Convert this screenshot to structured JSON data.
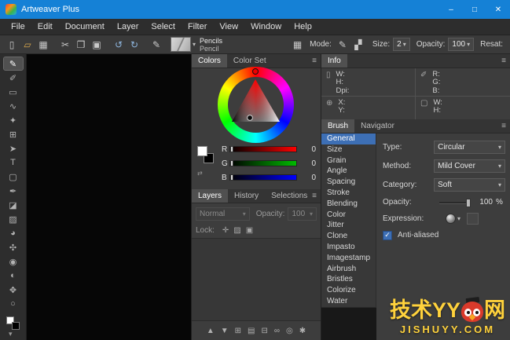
{
  "window": {
    "title": "Artweaver Plus",
    "minimize": "–",
    "maximize": "□",
    "close": "✕"
  },
  "menubar": {
    "items": [
      {
        "label": "File"
      },
      {
        "label": "Edit"
      },
      {
        "label": "Document"
      },
      {
        "label": "Layer"
      },
      {
        "label": "Select"
      },
      {
        "label": "Filter"
      },
      {
        "label": "View"
      },
      {
        "label": "Window"
      },
      {
        "label": "Help"
      }
    ]
  },
  "toolbar": {
    "icons": [
      {
        "name": "new-document-icon",
        "glyph": "▯"
      },
      {
        "name": "open-icon",
        "glyph": "▱",
        "color": "#d9a94e"
      },
      {
        "name": "save-icon",
        "glyph": "▦"
      },
      {
        "name": "cut-icon",
        "glyph": "✂"
      },
      {
        "name": "copy-icon",
        "glyph": "❐"
      },
      {
        "name": "paste-icon",
        "glyph": "▣"
      },
      {
        "name": "undo-icon",
        "glyph": "↺",
        "color": "#8fb7e0"
      },
      {
        "name": "redo-icon",
        "glyph": "↻",
        "color": "#8fb7e0"
      },
      {
        "name": "brush-icon",
        "glyph": "✎"
      }
    ],
    "brush_preset": {
      "line1": "Pencils",
      "line2": "Pencil"
    },
    "palette_icon": "▦",
    "mode_label": "Mode:",
    "mode_icons": [
      {
        "name": "paint-mode-icon",
        "glyph": "✎"
      },
      {
        "name": "erase-mode-icon",
        "glyph": "▞"
      }
    ],
    "size_label": "Size:",
    "size_value": "2",
    "opacity_label": "Opacity:",
    "opacity_value": "100",
    "resat_label": "Resat:"
  },
  "tools": [
    {
      "name": "brush-tool",
      "glyph": "✎",
      "selected": true
    },
    {
      "name": "pencil-tool",
      "glyph": "✐"
    },
    {
      "name": "rect-select-tool",
      "glyph": "▭"
    },
    {
      "name": "lasso-tool",
      "glyph": "∿"
    },
    {
      "name": "magic-wand-tool",
      "glyph": "✦"
    },
    {
      "name": "crop-tool",
      "glyph": "⊞"
    },
    {
      "name": "move-tool",
      "glyph": "➤"
    },
    {
      "name": "text-tool",
      "glyph": "T"
    },
    {
      "name": "shape-tool",
      "glyph": "▢"
    },
    {
      "name": "eyedropper-tool",
      "glyph": "✒"
    },
    {
      "name": "eraser-tool",
      "glyph": "◪"
    },
    {
      "name": "gradient-tool",
      "glyph": "▨"
    },
    {
      "name": "fill-tool",
      "glyph": "◕"
    },
    {
      "name": "smudge-tool",
      "glyph": "✣"
    },
    {
      "name": "clone-tool",
      "glyph": "◉"
    },
    {
      "name": "dodge-tool",
      "glyph": "◐"
    },
    {
      "name": "hand-tool",
      "glyph": "✥"
    },
    {
      "name": "zoom-tool",
      "glyph": "○"
    }
  ],
  "colors_panel": {
    "tabs": [
      {
        "label": "Colors",
        "selected": true
      },
      {
        "label": "Color Set"
      }
    ],
    "sliders": [
      {
        "label": "R",
        "value": "0",
        "color": "#ff0000"
      },
      {
        "label": "G",
        "value": "0",
        "color": "#00bb00"
      },
      {
        "label": "B",
        "value": "0",
        "color": "#0000ff"
      }
    ]
  },
  "layers_panel": {
    "tabs": [
      {
        "label": "Layers",
        "selected": true
      },
      {
        "label": "History"
      },
      {
        "label": "Selections"
      }
    ],
    "blend_mode": "Normal",
    "opacity_label": "Opacity:",
    "opacity_value": "100",
    "lock_label": "Lock:",
    "lock_icons": [
      {
        "name": "lock-position-icon",
        "glyph": "✛"
      },
      {
        "name": "lock-pixels-icon",
        "glyph": "▨"
      },
      {
        "name": "lock-all-icon",
        "glyph": "▣"
      }
    ],
    "bottom_icons": [
      {
        "name": "move-up-icon",
        "glyph": "▲"
      },
      {
        "name": "move-down-icon",
        "glyph": "▼"
      },
      {
        "name": "new-group-icon",
        "glyph": "⊞"
      },
      {
        "name": "new-layer-icon",
        "glyph": "▤"
      },
      {
        "name": "delete-layer-icon",
        "glyph": "⊟"
      },
      {
        "name": "link-layer-icon",
        "glyph": "∞"
      },
      {
        "name": "mask-icon",
        "glyph": "◎"
      },
      {
        "name": "layer-settings-icon",
        "glyph": "✱"
      }
    ]
  },
  "info_panel": {
    "title": "Info",
    "doc_fields": [
      "W:",
      "H:",
      "Dpi:"
    ],
    "color_fields": [
      "R:",
      "G:",
      "B:"
    ],
    "pos_fields": [
      "X:",
      "Y:"
    ],
    "sel_fields": [
      "W:",
      "H:"
    ]
  },
  "brush_panel": {
    "tabs": [
      {
        "label": "Brush",
        "selected": true
      },
      {
        "label": "Navigator"
      }
    ],
    "categories": [
      {
        "label": "General",
        "selected": true
      },
      {
        "label": "Size"
      },
      {
        "label": "Grain"
      },
      {
        "label": "Angle"
      },
      {
        "label": "Spacing"
      },
      {
        "label": "Stroke"
      },
      {
        "label": "Blending"
      },
      {
        "label": "Color"
      },
      {
        "label": "Jitter"
      },
      {
        "label": "Clone"
      },
      {
        "label": "Impasto"
      },
      {
        "label": "Imagestamp"
      },
      {
        "label": "Airbrush"
      },
      {
        "label": "Bristles"
      },
      {
        "label": "Colorize"
      },
      {
        "label": "Water"
      }
    ],
    "type_label": "Type:",
    "type_value": "Circular",
    "method_label": "Method:",
    "method_value": "Mild Cover",
    "category_label": "Category:",
    "category_value": "Soft",
    "opacity_label": "Opacity:",
    "opacity_value": "100",
    "opacity_unit": "%",
    "expression_label": "Expression:",
    "antialiased_label": "Anti-aliased",
    "antialiased_checked": true
  },
  "watermark": {
    "line1_left": "技术YY",
    "line1_right": "网",
    "line2": "JISHUYY.COM"
  },
  "colors": {
    "titlebar_blue": "#1581d6",
    "selection_blue": "#3d6fb5",
    "panel_gray": "#3d3d3d",
    "watermark_yellow": "#ffd23c"
  }
}
